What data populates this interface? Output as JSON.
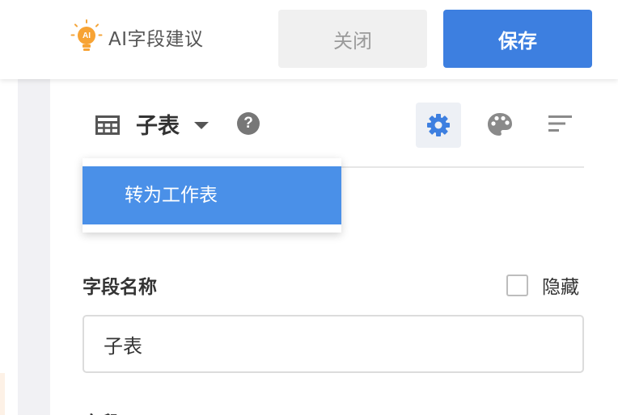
{
  "topbar": {
    "brand_badge": "AI",
    "brand_label": "AI字段建议",
    "close_label": "关闭",
    "save_label": "保存"
  },
  "toolbar": {
    "title": "子表",
    "help_glyph": "?",
    "icons": [
      "table-icon",
      "chevron-down-icon",
      "help-icon",
      "gear-icon",
      "palette-icon",
      "sort-icon"
    ],
    "active_icon_color": "#3d7fe0"
  },
  "dropdown": {
    "items": [
      {
        "label": "转为工作表",
        "highlighted": true
      }
    ]
  },
  "field": {
    "label": "字段名称",
    "hide_label": "隐藏",
    "hide_checked": false,
    "name_value": "子表",
    "next_label": "字段"
  },
  "colors": {
    "primary": "#3d7fe0",
    "dropdown_highlight": "#4a90e8",
    "close_button_bg": "#f0f0f0",
    "bulb": "#f7a334"
  }
}
